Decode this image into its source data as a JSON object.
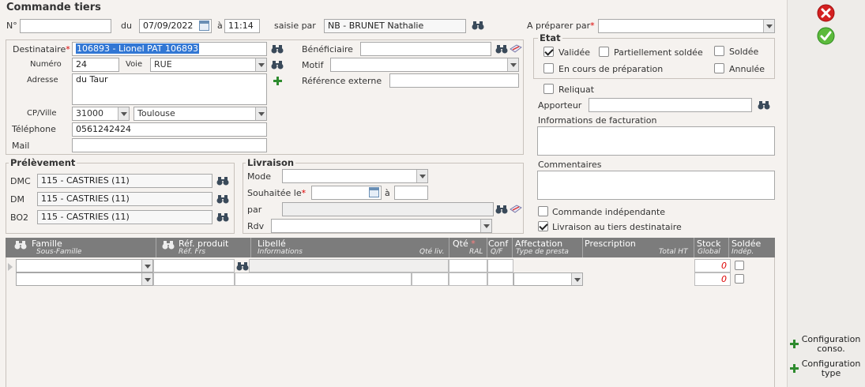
{
  "page": {
    "title": "Commande tiers"
  },
  "header": {
    "numero_label": "N°",
    "numero_value": "",
    "du_label": "du",
    "date_value": "07/09/2022",
    "a_label": "à",
    "time_value": "11:14",
    "saisie_label": "saisie par",
    "saisie_value": "NB - BRUNET Nathalie",
    "preparer_label": "A préparer par",
    "preparer_value": ""
  },
  "destinataire": {
    "label": "Destinataire",
    "value": "106893 - Lionel PAT 106893",
    "numero_label": "Numéro",
    "numero_value": "24",
    "voie_label": "Voie",
    "voie_value": "RUE",
    "adresse_label": "Adresse",
    "adresse_value": "du Taur",
    "cpville_label": "CP/Ville",
    "cp_value": "31000",
    "ville_value": "Toulouse",
    "telephone_label": "Téléphone",
    "telephone_value": "0561242424",
    "mail_label": "Mail",
    "mail_value": ""
  },
  "beneficiaire": {
    "label": "Bénéficiaire",
    "value": "",
    "motif_label": "Motif",
    "motif_value": "",
    "ref_label": "Référence externe",
    "ref_value": ""
  },
  "etat": {
    "title": "Etat",
    "items": [
      {
        "label": "Validée",
        "checked": true
      },
      {
        "label": "Partiellement soldée",
        "checked": false
      },
      {
        "label": "Soldée",
        "checked": false
      },
      {
        "label": "En cours de préparation",
        "checked": false
      },
      {
        "label": "Annulée",
        "checked": false
      }
    ]
  },
  "right_form": {
    "reliquat_label": "Reliquat",
    "apporteur_label": "Apporteur",
    "apporteur_value": "",
    "facturation_label": "Informations de facturation",
    "commentaires_label": "Commentaires",
    "independante_label": "Commande indépendante",
    "livraison_tiers_label": "Livraison au tiers destinataire"
  },
  "prelevement": {
    "title": "Prélèvement",
    "rows": [
      {
        "label": "DMC",
        "value": "115 - CASTRIES (11)"
      },
      {
        "label": "DM",
        "value": "115 - CASTRIES (11)"
      },
      {
        "label": "BO2",
        "value": "115 - CASTRIES (11)"
      }
    ]
  },
  "livraison": {
    "title": "Livraison",
    "mode_label": "Mode",
    "souhaitee_label": "Souhaitée le",
    "a_label": "à",
    "par_label": "par",
    "rdv_label": "Rdv"
  },
  "table": {
    "columns": {
      "famille": "Famille",
      "sous_famille": "Sous-Famille",
      "ref_produit": "Réf. produit",
      "ref_frs": "Réf. Frs",
      "libelle": "Libellé",
      "informations": "Informations",
      "qte_liv": "Qté liv.",
      "qte": "Qté",
      "ral": "RAL",
      "conf": "Conf",
      "qf": "Q/F",
      "affectation": "Affectation",
      "type_presta": "Type de presta",
      "prescription": "Prescription",
      "total_ht": "Total HT",
      "stock": "Stock",
      "global": "Global",
      "soldee": "Soldée",
      "indep": "Indép."
    },
    "row_stock_1": "0",
    "row_stock_2": "0"
  },
  "side": {
    "config_conso_l1": "Configuration",
    "config_conso_l2": "conso.",
    "config_type_l1": "Configuration",
    "config_type_l2": "type"
  },
  "colors": {
    "accent_red": "#d00000",
    "header_gray": "#7c7c7c",
    "ok_green": "#3a9a2a",
    "cancel_red": "#d42020"
  }
}
